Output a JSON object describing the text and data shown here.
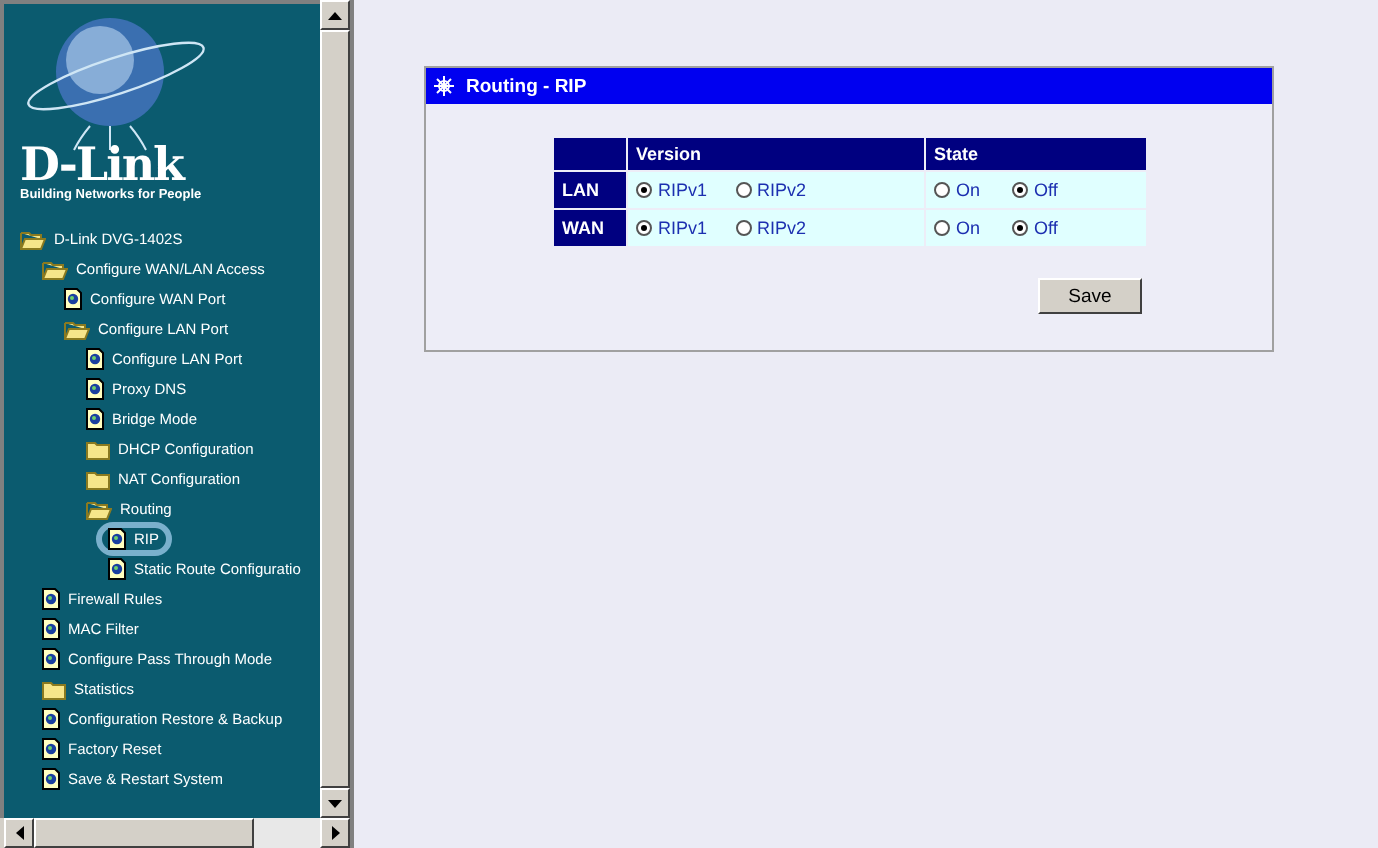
{
  "sidebar": {
    "logo": {
      "brand": "D-Link",
      "tagline": "Building Networks for People"
    },
    "tree": [
      {
        "label": "D-Link DVG-1402S",
        "kind": "folder-open",
        "selected": false,
        "children": [
          {
            "label": "Configure WAN/LAN Access",
            "kind": "folder-open",
            "selected": false,
            "children": [
              {
                "label": "Configure WAN Port",
                "kind": "page",
                "selected": false
              },
              {
                "label": "Configure LAN Port",
                "kind": "folder-open",
                "selected": false,
                "children": [
                  {
                    "label": "Configure LAN Port",
                    "kind": "page",
                    "selected": false
                  },
                  {
                    "label": "Proxy DNS",
                    "kind": "page",
                    "selected": false
                  },
                  {
                    "label": "Bridge Mode",
                    "kind": "page",
                    "selected": false
                  },
                  {
                    "label": "DHCP Configuration",
                    "kind": "folder",
                    "selected": false
                  },
                  {
                    "label": "NAT Configuration",
                    "kind": "folder",
                    "selected": false
                  },
                  {
                    "label": "Routing",
                    "kind": "folder-open",
                    "selected": false,
                    "children": [
                      {
                        "label": "RIP",
                        "kind": "page",
                        "selected": true
                      },
                      {
                        "label": "Static Route Configuratio",
                        "kind": "page",
                        "selected": false
                      }
                    ]
                  }
                ]
              }
            ]
          },
          {
            "label": "Firewall Rules",
            "kind": "page",
            "selected": false
          },
          {
            "label": "MAC Filter",
            "kind": "page",
            "selected": false
          },
          {
            "label": "Configure Pass Through Mode",
            "kind": "page",
            "selected": false
          },
          {
            "label": "Statistics",
            "kind": "folder",
            "selected": false
          },
          {
            "label": "Configuration Restore & Backup",
            "kind": "page",
            "selected": false
          },
          {
            "label": "Factory Reset",
            "kind": "page",
            "selected": false
          },
          {
            "label": "Save & Restart System",
            "kind": "page",
            "selected": false
          }
        ]
      }
    ]
  },
  "panel": {
    "title": "Routing - RIP",
    "table": {
      "columns": [
        "Version",
        "State"
      ],
      "rows": [
        {
          "label": "LAN",
          "version": [
            {
              "label": "RIPv1",
              "selected": true
            },
            {
              "label": "RIPv2",
              "selected": false
            }
          ],
          "state": [
            {
              "label": "On",
              "selected": false
            },
            {
              "label": "Off",
              "selected": true
            }
          ]
        },
        {
          "label": "WAN",
          "version": [
            {
              "label": "RIPv1",
              "selected": true
            },
            {
              "label": "RIPv2",
              "selected": false
            }
          ],
          "state": [
            {
              "label": "On",
              "selected": false
            },
            {
              "label": "Off",
              "selected": true
            }
          ]
        }
      ]
    },
    "save_button": "Save"
  }
}
